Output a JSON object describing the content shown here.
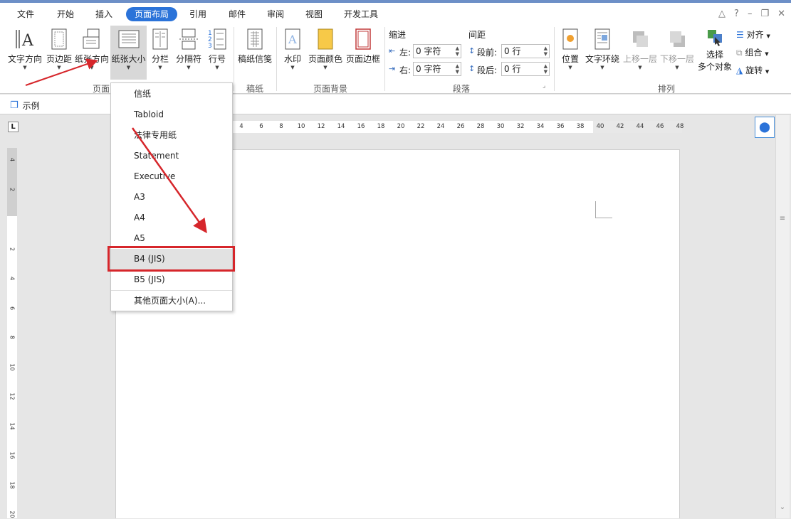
{
  "menu": {
    "tabs": [
      {
        "label": "文件",
        "active": false
      },
      {
        "label": "开始",
        "active": false
      },
      {
        "label": "插入",
        "active": false
      },
      {
        "label": "页面布局",
        "active": true
      },
      {
        "label": "引用",
        "active": false
      },
      {
        "label": "邮件",
        "active": false
      },
      {
        "label": "审阅",
        "active": false
      },
      {
        "label": "视图",
        "active": false
      },
      {
        "label": "开发工具",
        "active": false
      }
    ],
    "window_controls": [
      "△",
      "?",
      "–",
      "❐",
      "✕"
    ]
  },
  "ribbon": {
    "page_setup": {
      "text_direction": "文字方向",
      "margins": "页边距",
      "orientation": "纸张方向",
      "size": "纸张大小",
      "columns": "分栏",
      "breaks": "分隔符",
      "line_numbers": "行号",
      "group_label": "页面"
    },
    "manuscript": {
      "button": "稿纸信笺",
      "group_label": "稿纸"
    },
    "page_background": {
      "watermark": "水印",
      "page_color": "页面颜色",
      "page_borders": "页面边框",
      "group_label": "页面背景"
    },
    "paragraph": {
      "indent_title": "缩进",
      "spacing_title": "间距",
      "left_label": "左:",
      "left_value": "0 字符",
      "right_label": "右:",
      "right_value": "0 字符",
      "before_label": "段前:",
      "before_value": "0 行",
      "after_label": "段后:",
      "after_value": "0 行",
      "group_label": "段落"
    },
    "arrange": {
      "position": "位置",
      "wrap_text": "文字环绕",
      "bring_forward": "上移一层",
      "send_backward": "下移一层",
      "selection_pane_1": "选择",
      "selection_pane_2": "多个对象",
      "align": "对齐",
      "group": "组合",
      "rotate": "旋转",
      "group_label": "排列"
    }
  },
  "doc_tab": {
    "name": "示例"
  },
  "ruler": {
    "h_ticks": [
      "4",
      "6",
      "8",
      "10",
      "12",
      "14",
      "16",
      "18",
      "20",
      "22",
      "24",
      "26",
      "28",
      "30",
      "32",
      "34",
      "36",
      "38",
      "40",
      "42",
      "44",
      "46",
      "48"
    ],
    "v_ticks": [
      "4",
      "2",
      "2",
      "4",
      "6",
      "8",
      "10",
      "12",
      "14",
      "16",
      "18",
      "20"
    ],
    "corner": "L"
  },
  "paper_size_menu": {
    "items": [
      {
        "label": "信纸",
        "selected": false
      },
      {
        "label": "Tabloid",
        "selected": false
      },
      {
        "label": "法律专用纸",
        "selected": false
      },
      {
        "label": "Statement",
        "selected": false
      },
      {
        "label": "Executive",
        "selected": false
      },
      {
        "label": "A3",
        "selected": false
      },
      {
        "label": "A4",
        "selected": false
      },
      {
        "label": "A5",
        "selected": false
      },
      {
        "label": "B4 (JIS)",
        "selected": true
      },
      {
        "label": "B5 (JIS)",
        "selected": false
      }
    ],
    "more": "其他页面大小(A)..."
  },
  "colors": {
    "accent": "#2b73d9",
    "annotation": "#d6262b",
    "highlight": "#e2e2e2"
  }
}
